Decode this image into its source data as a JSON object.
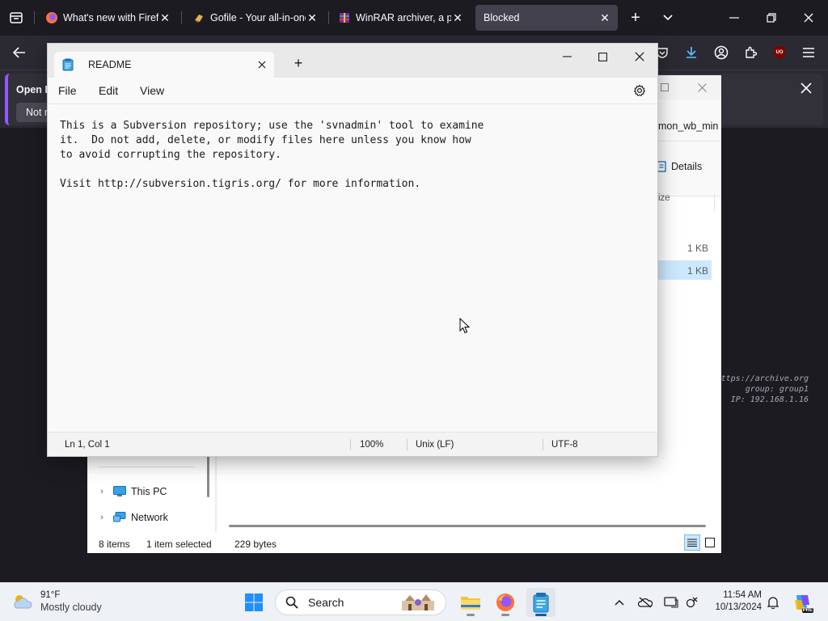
{
  "firefox": {
    "tabs": [
      {
        "title": "What's new with Firefox",
        "active": false
      },
      {
        "title": "Gofile - Your all-in-one",
        "active": false
      },
      {
        "title": "WinRAR archiver, a powerful",
        "active": false
      },
      {
        "title": "Blocked",
        "active": true
      }
    ],
    "notification": {
      "title": "Open F",
      "button": "Not n"
    },
    "accent_color": "#9059ff"
  },
  "page_watermark": {
    "line1": "ttps://archive.org",
    "line2": "group: group1",
    "line3": "IP: 192.168.1.16"
  },
  "explorer": {
    "address_fragment": "mon_wb_min",
    "details_label": "Details",
    "column_header": "ize",
    "rows": [
      {
        "size": "1 KB",
        "selected": false
      },
      {
        "size": "1 KB",
        "selected": true
      }
    ],
    "nav_items": [
      {
        "label": "This PC",
        "icon": "monitor-icon"
      },
      {
        "label": "Network",
        "icon": "network-icon"
      }
    ],
    "status": {
      "items": "8 items",
      "selected": "1 item selected",
      "size": "229 bytes"
    }
  },
  "notepad": {
    "tab_title": "README",
    "menu": [
      "File",
      "Edit",
      "View"
    ],
    "content": "This is a Subversion repository; use the 'svnadmin' tool to examine\nit.  Do not add, delete, or modify files here unless you know how\nto avoid corrupting the repository.\n\nVisit http://subversion.tigris.org/ for more information.",
    "status": {
      "position": "Ln 1, Col 1",
      "zoom": "100%",
      "line_ending": "Unix (LF)",
      "encoding": "UTF-8"
    }
  },
  "taskbar": {
    "weather": {
      "temp": "91°F",
      "condition": "Mostly cloudy"
    },
    "search_placeholder": "Search",
    "clock": {
      "time": "11:54 AM",
      "date": "10/13/2024"
    },
    "copilot_badge": "PRE",
    "ublock_badge": "UO"
  }
}
